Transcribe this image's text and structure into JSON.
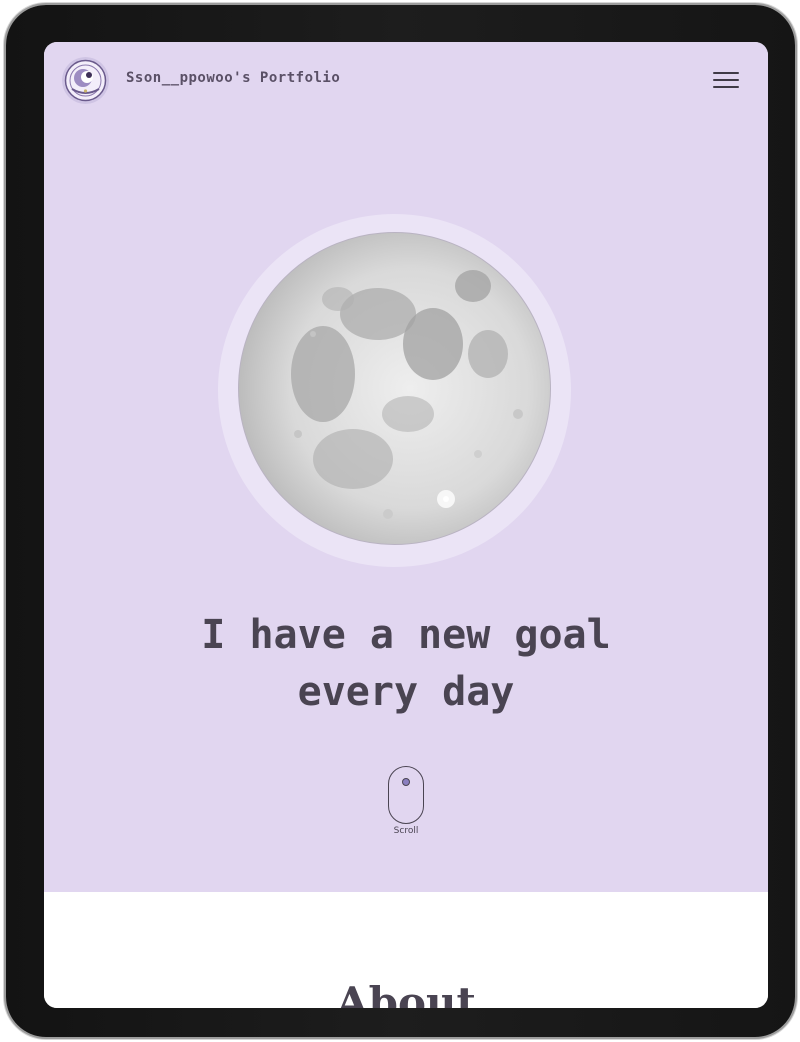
{
  "header": {
    "site_title": "Sson__ppowoo's Portfolio",
    "logo_icon": "portfolio-logo-emblem",
    "menu_icon": "hamburger-menu-icon"
  },
  "hero": {
    "image_icon": "full-moon-image",
    "headline_lines": [
      "I have a new goal",
      "every day"
    ],
    "scroll_label": "Scroll",
    "scroll_icon": "mouse-scroll-icon"
  },
  "about": {
    "heading": "About"
  },
  "colors": {
    "hero_background": "#e1d6f0",
    "moon_halo": "#ebe4f6",
    "text_primary": "#4a4452",
    "accent_dot": "#8a7fbf",
    "about_background": "#ffffff"
  }
}
